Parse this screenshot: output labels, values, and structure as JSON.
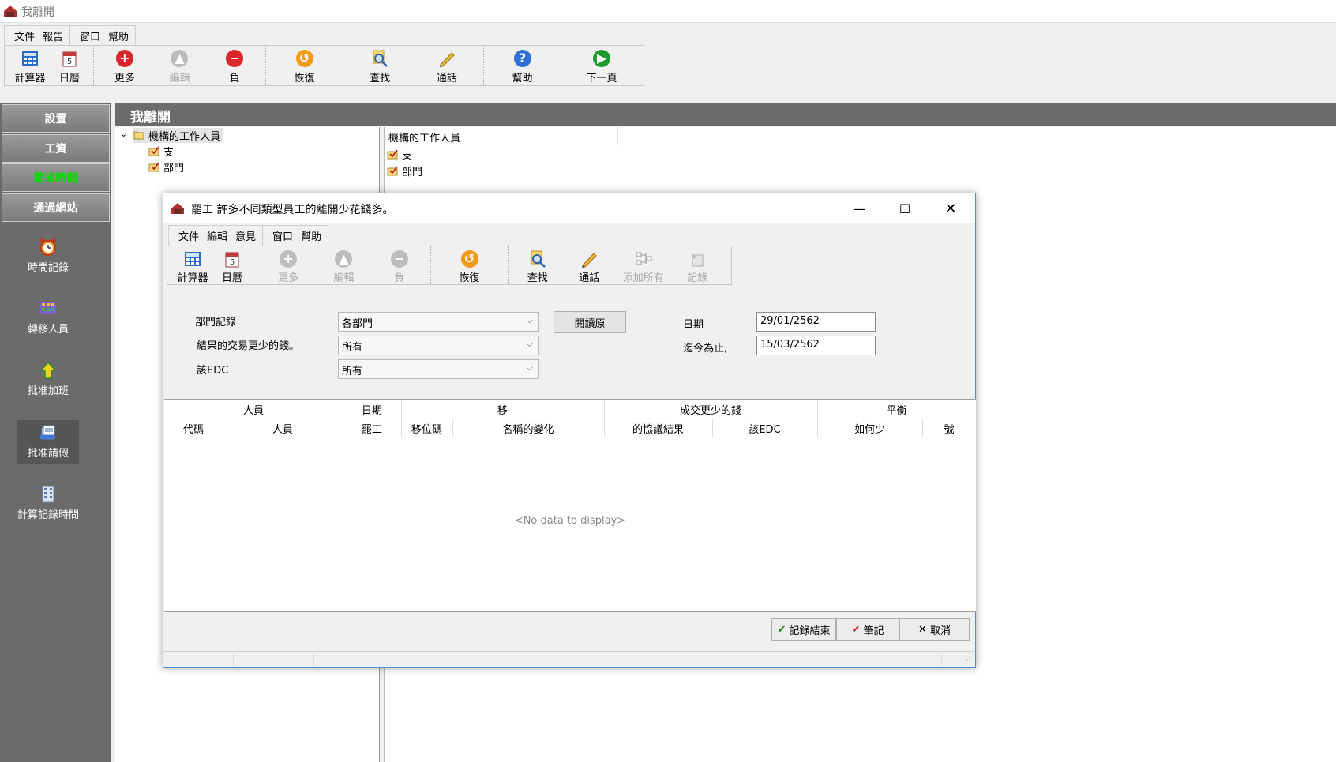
{
  "app": {
    "title": "我離開"
  },
  "main_menu": {
    "file": "文件",
    "report": "報告",
    "window": "窗口",
    "help": "幫助"
  },
  "main_toolbar": {
    "calculator": "計算器",
    "calendar": "日曆",
    "more": "更多",
    "edit": "編輯",
    "negative": "負",
    "restore": "恢復",
    "find": "查找",
    "call": "通話",
    "help": "幫助",
    "next_page": "下一頁"
  },
  "sidebar": {
    "settings": "設置",
    "wages": "工資",
    "save_time": "節省時間",
    "via_website": "通過網站",
    "items": [
      "時間記錄",
      "轉移人員",
      "批准加班",
      "批准請假",
      "計算記錄時間"
    ],
    "accent_color": "#00e000"
  },
  "main": {
    "title": "我離開",
    "tree": {
      "root": "機構的工作人員",
      "children": [
        "支",
        "部門"
      ]
    },
    "list": {
      "header": "機構的工作人員",
      "items": [
        "支",
        "部門"
      ]
    }
  },
  "dialog": {
    "title": "罷工 許多不同類型員工的離開少花錢多。",
    "menu": {
      "file": "文件",
      "edit": "編輯",
      "view": "意見",
      "window": "窗口",
      "help": "幫助"
    },
    "toolbar": {
      "calculator": "計算器",
      "calendar": "日曆",
      "more": "更多",
      "edit": "編輯",
      "negative": "負",
      "restore": "恢復",
      "find": "查找",
      "call": "通話",
      "add_all": "添加所有",
      "record": "記錄"
    },
    "filters": {
      "dept_label": "部門記錄",
      "dept_value": "各部門",
      "result_label": "結果的交易更少的錢。",
      "result_value": "所有",
      "edc_label": "該EDC",
      "edc_value": "所有",
      "read_button": "閱讀原",
      "date_label": "日期",
      "date_value": "29/01/2562",
      "until_label": "迄今為止,",
      "until_value": "15/03/2562"
    },
    "grid": {
      "group_headers": {
        "person": "人員",
        "date": "日期",
        "move": "移",
        "deal": "成交更少的錢",
        "balance": "平衡"
      },
      "columns": {
        "code": "代碼",
        "person": "人員",
        "strike": "罷工",
        "move_code": "移位碼",
        "name_change": "名稱的變化",
        "agreement": "的協議結果",
        "edc": "該EDC",
        "how_less": "如何少",
        "number": "號"
      },
      "empty": "<No data to display>"
    },
    "buttons": {
      "finish": "記錄結束",
      "note": "筆記",
      "cancel": "取消"
    }
  }
}
